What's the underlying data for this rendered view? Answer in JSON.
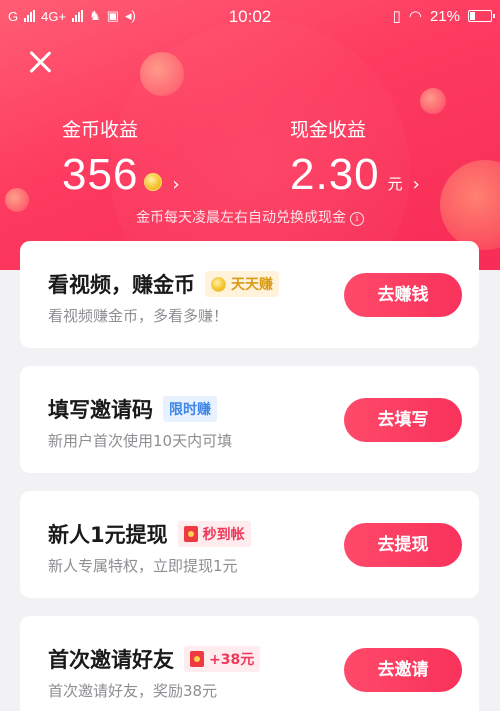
{
  "status_bar": {
    "carrier": "G",
    "network": "4G+",
    "time": "10:02",
    "battery_percent": "21%"
  },
  "header": {
    "gold": {
      "label": "金币收益",
      "value": "356"
    },
    "cash": {
      "label": "现金收益",
      "value": "2.30",
      "unit": "元"
    },
    "note": "金币每天凌晨左右自动兑换成现金"
  },
  "tasks": [
    {
      "title": "看视频，赚金币",
      "tag": "天天赚",
      "subtitle": "看视频赚金币，多看多赚！",
      "button": "去赚钱"
    },
    {
      "title": "填写邀请码",
      "tag": "限时赚",
      "subtitle": "新用户首次使用10天内可填",
      "button": "去填写"
    },
    {
      "title": "新人1元提现",
      "tag": "秒到帐",
      "subtitle": "新人专属特权，立即提现1元",
      "button": "去提现"
    },
    {
      "title": "首次邀请好友",
      "tag": "+38元",
      "subtitle": "首次邀请好友，奖励38元",
      "button": "去邀请"
    }
  ],
  "colors": {
    "accent": "#f8325b",
    "hero_top": "#ff5d74",
    "gold_tag": "#d99b16",
    "blue_tag": "#3f86e8"
  }
}
